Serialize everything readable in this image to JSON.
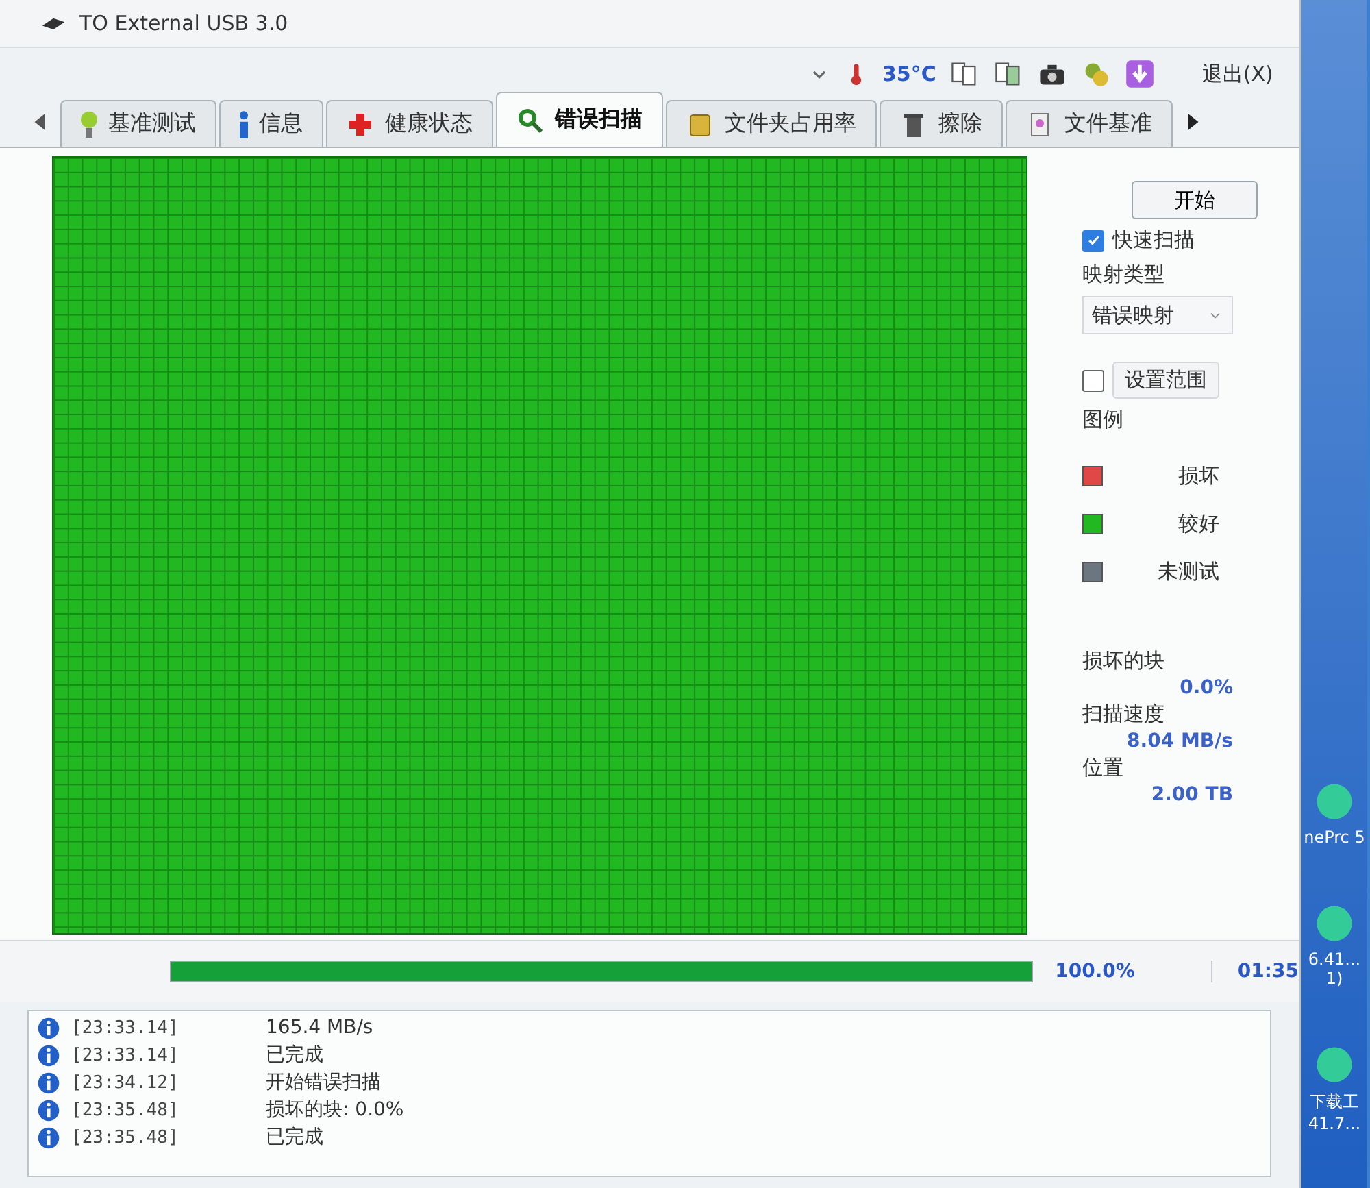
{
  "window": {
    "title": "TO External USB 3.0"
  },
  "toolbar": {
    "temperature": "35°C",
    "exit_button": "退出(X)"
  },
  "tabs": [
    {
      "label": "基准测试",
      "selected": false
    },
    {
      "label": "信息",
      "selected": false
    },
    {
      "label": "健康状态",
      "selected": false
    },
    {
      "label": "错误扫描",
      "selected": true
    },
    {
      "label": "文件夹占用率",
      "selected": false
    },
    {
      "label": "擦除",
      "selected": false
    },
    {
      "label": "文件基准",
      "selected": false
    }
  ],
  "scan_panel": {
    "start_button": "开始",
    "quick_scan": {
      "label": "快速扫描",
      "checked": true
    },
    "map_type_label": "映射类型",
    "map_type": "错误映射",
    "set_range": {
      "label": "设置范围",
      "checked": false
    },
    "legend_title": "图例",
    "legend": [
      {
        "label": "损坏",
        "color": "#e04848"
      },
      {
        "label": "较好",
        "color": "#22b822"
      },
      {
        "label": "未测试",
        "color": "#6c7680"
      }
    ],
    "stats": [
      {
        "label": "损坏的块",
        "value": "0.0%"
      },
      {
        "label": "扫描速度",
        "value": "8.04 MB/s"
      },
      {
        "label": "位置",
        "value": "2.00 TB"
      }
    ]
  },
  "progress": {
    "level": 1,
    "percent": "100.0%",
    "time": "01:35"
  },
  "log": [
    {
      "time": "[23:33.14]",
      "message": "165.4 MB/s"
    },
    {
      "time": "[23:33.14]",
      "message": "已完成"
    },
    {
      "time": "[23:34.12]",
      "message": "开始错误扫描"
    },
    {
      "time": "[23:35.48]",
      "message": "损坏的块: 0.0%"
    },
    {
      "time": "[23:35.48]",
      "message": "已完成"
    }
  ],
  "desktop_icons": [
    {
      "label": "nePrc 5"
    },
    {
      "label": "6.41... 1)"
    },
    {
      "label": "下载工 41.7..."
    }
  ]
}
